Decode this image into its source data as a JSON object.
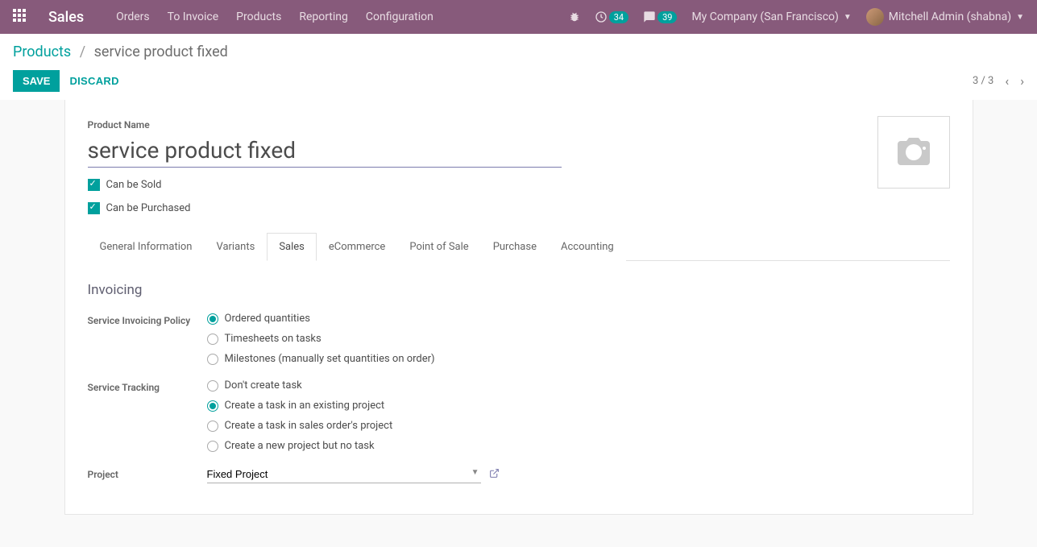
{
  "nav": {
    "app_title": "Sales",
    "links": [
      "Orders",
      "To Invoice",
      "Products",
      "Reporting",
      "Configuration"
    ],
    "activities_count": "34",
    "messages_count": "39",
    "company": "My Company (San Francisco)",
    "user": "Mitchell Admin (shabna)"
  },
  "breadcrumb": {
    "parent": "Products",
    "current": "service product fixed"
  },
  "actions": {
    "save": "SAVE",
    "discard": "DISCARD",
    "pager": "3 / 3"
  },
  "form": {
    "product_name_label": "Product Name",
    "product_name_value": "service product fixed",
    "can_be_sold": "Can be Sold",
    "can_be_purchased": "Can be Purchased"
  },
  "tabs": [
    "General Information",
    "Variants",
    "Sales",
    "eCommerce",
    "Point of Sale",
    "Purchase",
    "Accounting"
  ],
  "sales_tab": {
    "section_invoicing": "Invoicing",
    "invoicing_policy_label": "Service Invoicing Policy",
    "invoicing_policy_options": [
      "Ordered quantities",
      "Timesheets on tasks",
      "Milestones (manually set quantities on order)"
    ],
    "service_tracking_label": "Service Tracking",
    "service_tracking_options": [
      "Don't create task",
      "Create a task in an existing project",
      "Create a task in sales order's project",
      "Create a new project but no task"
    ],
    "project_label": "Project",
    "project_value": "Fixed Project"
  }
}
